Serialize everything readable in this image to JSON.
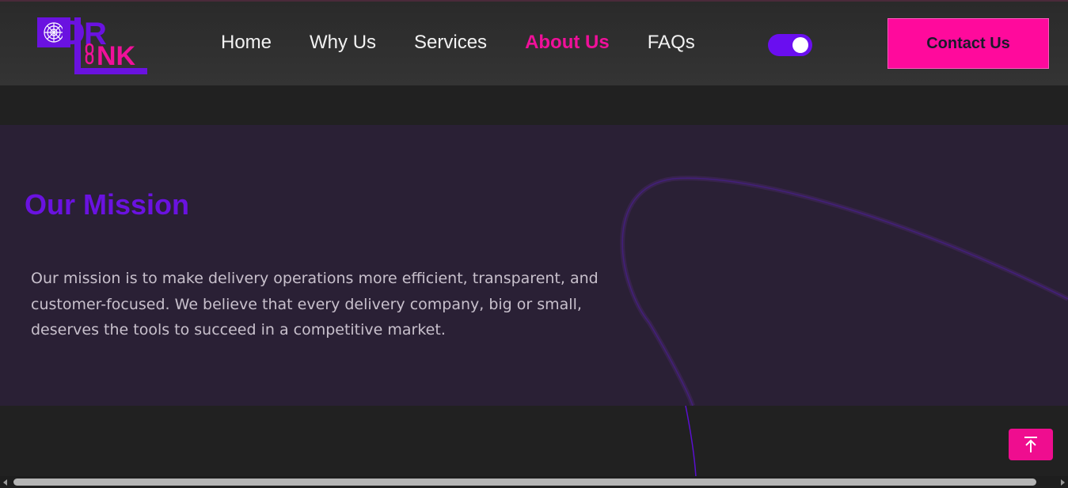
{
  "header": {
    "logo_text_top": "R",
    "logo_text_bottom": "NK",
    "logo_letter_left": "D",
    "logo_letter_l": "L",
    "nav": [
      {
        "label": "Home",
        "active": false
      },
      {
        "label": "Why Us",
        "active": false
      },
      {
        "label": "Services",
        "active": false
      },
      {
        "label": "About Us",
        "active": true
      },
      {
        "label": "FAQs",
        "active": false
      }
    ],
    "theme_toggle": {
      "on": true
    },
    "contact_label": "Contact Us"
  },
  "mission": {
    "title": "Our Mission",
    "text": "Our mission is to make delivery operations more efficient, transparent, and customer-focused. We believe that every delivery company, big or small, deserves the tools to succeed in a competitive market."
  },
  "icons": {
    "logo_web": "spider-web-icon",
    "logo_link": "chain-link-icon",
    "scroll_top": "arrow-up-to-line-icon"
  },
  "colors": {
    "accent_pink": "#ff0a9c",
    "accent_purple": "#6a0ef0",
    "background": "#212121",
    "mission_bg": "#2a2035"
  }
}
